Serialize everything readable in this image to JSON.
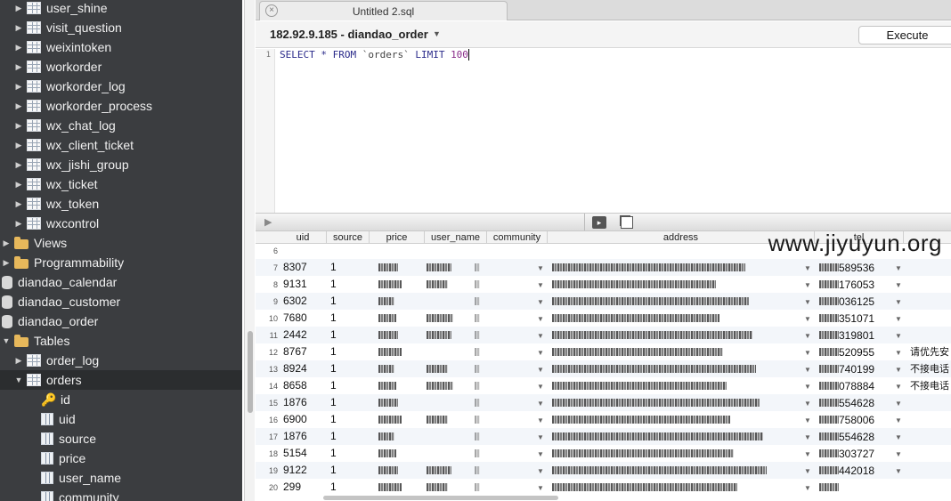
{
  "sidebar": {
    "items": [
      {
        "type": "table",
        "label": "user_shine",
        "indent": 1
      },
      {
        "type": "table",
        "label": "visit_question",
        "indent": 1
      },
      {
        "type": "table",
        "label": "weixintoken",
        "indent": 1
      },
      {
        "type": "table",
        "label": "workorder",
        "indent": 1
      },
      {
        "type": "table",
        "label": "workorder_log",
        "indent": 1
      },
      {
        "type": "table",
        "label": "workorder_process",
        "indent": 1
      },
      {
        "type": "table",
        "label": "wx_chat_log",
        "indent": 1
      },
      {
        "type": "table",
        "label": "wx_client_ticket",
        "indent": 1
      },
      {
        "type": "table",
        "label": "wx_jishi_group",
        "indent": 1
      },
      {
        "type": "table",
        "label": "wx_ticket",
        "indent": 1
      },
      {
        "type": "table",
        "label": "wx_token",
        "indent": 1
      },
      {
        "type": "table",
        "label": "wxcontrol",
        "indent": 1
      },
      {
        "type": "folder",
        "label": "Views",
        "indent": 0
      },
      {
        "type": "folder",
        "label": "Programmability",
        "indent": 0
      },
      {
        "type": "db",
        "label": "diandao_calendar",
        "indent": -1
      },
      {
        "type": "db",
        "label": "diandao_customer",
        "indent": -1
      },
      {
        "type": "db",
        "label": "diandao_order",
        "indent": -1
      },
      {
        "type": "folder",
        "label": "Tables",
        "indent": 0,
        "expanded": true
      },
      {
        "type": "table",
        "label": "order_log",
        "indent": 1
      },
      {
        "type": "table",
        "label": "orders",
        "indent": 1,
        "expanded": true,
        "selected": true
      },
      {
        "type": "key",
        "label": "id",
        "indent": 2
      },
      {
        "type": "column",
        "label": "uid",
        "indent": 2
      },
      {
        "type": "column",
        "label": "source",
        "indent": 2
      },
      {
        "type": "column",
        "label": "price",
        "indent": 2
      },
      {
        "type": "column",
        "label": "user_name",
        "indent": 2
      },
      {
        "type": "column",
        "label": "community",
        "indent": 2
      }
    ]
  },
  "tab": {
    "title": "Untitled 2.sql",
    "close_glyph": "×"
  },
  "connection": {
    "label": "182.92.9.185 - diandao_order"
  },
  "toolbar": {
    "execute_label": "Execute"
  },
  "editor": {
    "line_number": "1",
    "sql": {
      "kw1": "SELECT * FROM ",
      "table": "`orders`",
      "kw2": " LIMIT ",
      "limit": "100"
    }
  },
  "grid": {
    "columns": [
      "uid",
      "source",
      "price",
      "user_name",
      "community",
      "address",
      "tel"
    ],
    "rows": [
      {
        "n": "6",
        "uid": "",
        "source": "",
        "note": ""
      },
      {
        "n": "7",
        "uid": "8307",
        "source": "1",
        "tel_tail": "589536",
        "note": ""
      },
      {
        "n": "8",
        "uid": "9131",
        "source": "1",
        "tel_tail": "176053",
        "note": ""
      },
      {
        "n": "9",
        "uid": "6302",
        "source": "1",
        "tel_tail": "036125",
        "note": ""
      },
      {
        "n": "10",
        "uid": "7680",
        "source": "1",
        "tel_tail": "351071",
        "note": ""
      },
      {
        "n": "11",
        "uid": "2442",
        "source": "1",
        "tel_tail": "319801",
        "note": ""
      },
      {
        "n": "12",
        "uid": "8767",
        "source": "1",
        "tel_tail": "520955",
        "note": "请优先安"
      },
      {
        "n": "13",
        "uid": "8924",
        "source": "1",
        "tel_tail": "740199",
        "note": "不接电话"
      },
      {
        "n": "14",
        "uid": "8658",
        "source": "1",
        "tel_tail": "078884",
        "note": "不接电话"
      },
      {
        "n": "15",
        "uid": "1876",
        "source": "1",
        "tel_tail": "554628",
        "note": ""
      },
      {
        "n": "16",
        "uid": "6900",
        "source": "1",
        "tel_tail": "758006",
        "note": ""
      },
      {
        "n": "17",
        "uid": "1876",
        "source": "1",
        "tel_tail": "554628",
        "note": ""
      },
      {
        "n": "18",
        "uid": "5154",
        "source": "1",
        "tel_tail": "303727",
        "note": ""
      },
      {
        "n": "19",
        "uid": "9122",
        "source": "1",
        "tel_tail": "442018",
        "note": ""
      },
      {
        "n": "20",
        "uid": "299",
        "source": "1",
        "tel_tail": "",
        "note": ""
      }
    ]
  },
  "watermark": "www.jiyuyun.org",
  "icons": {
    "tree_collapsed": "▶",
    "tree_expanded": "▼",
    "play": "▶",
    "key": "🔑"
  }
}
